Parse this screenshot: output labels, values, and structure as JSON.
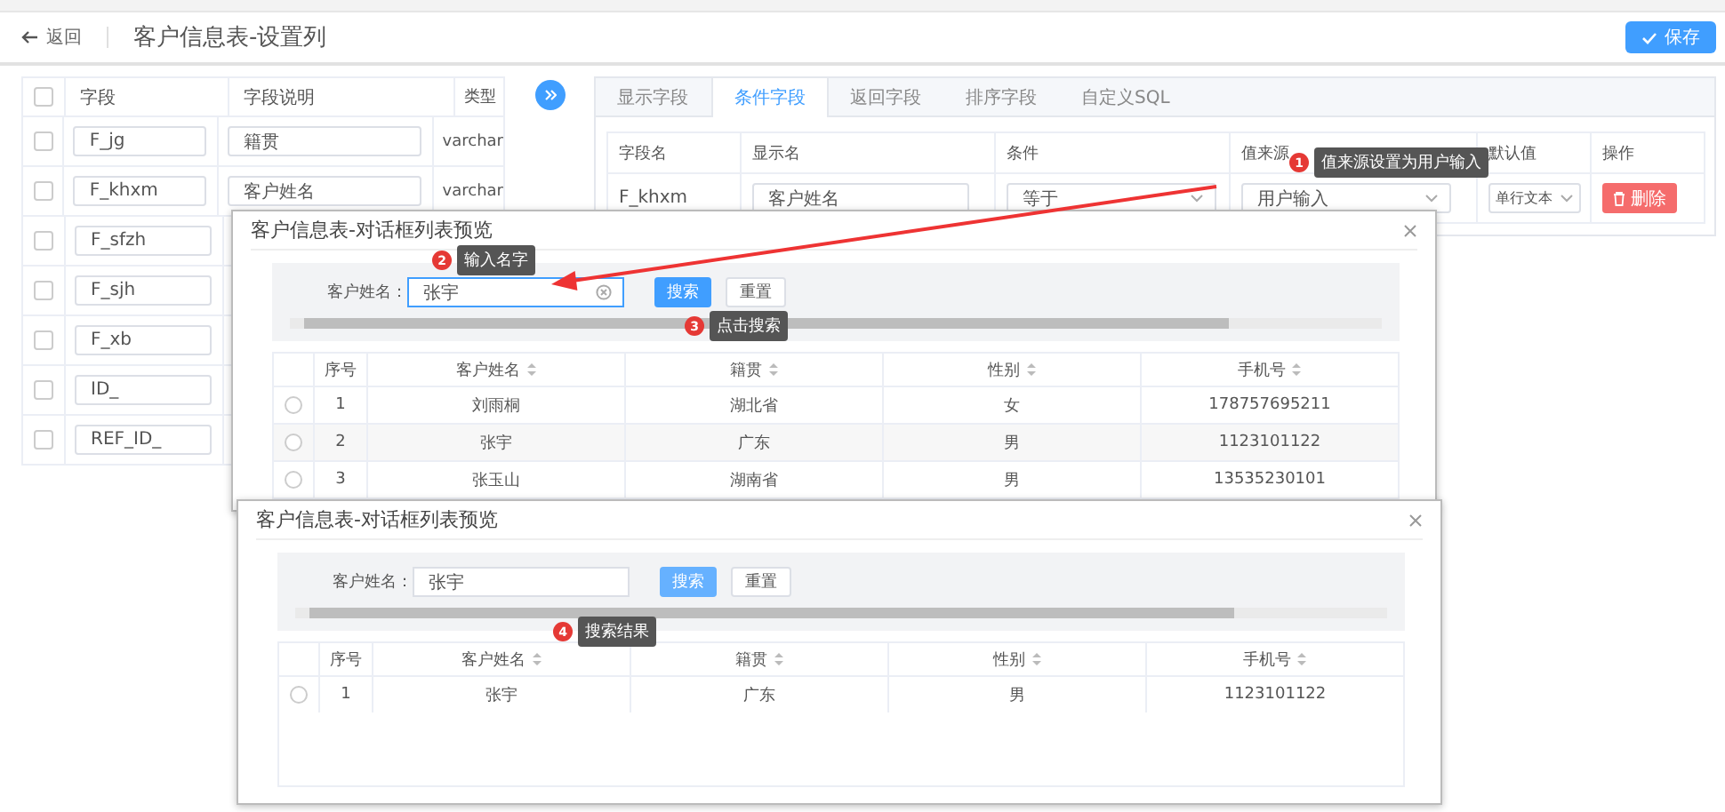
{
  "header": {
    "back": "返回",
    "title": "客户信息表-设置列",
    "save": "保存"
  },
  "field_table": {
    "all_checked": false,
    "columns": [
      "字段",
      "字段说明",
      "类型"
    ],
    "rows": [
      {
        "field": "F_jg",
        "description": "籍贯",
        "type": "varchar",
        "checked": false
      },
      {
        "field": "F_khxm",
        "description": "客户姓名",
        "type": "varchar",
        "checked": false
      },
      {
        "field": "F_sfzh",
        "checked": false
      },
      {
        "field": "F_sjh",
        "checked": false
      },
      {
        "field": "F_xb",
        "checked": false
      },
      {
        "field": "ID_",
        "checked": false
      },
      {
        "field": "REF_ID_",
        "checked": false
      }
    ]
  },
  "config_panel": {
    "tabs": [
      {
        "label": "显示字段",
        "selected": false
      },
      {
        "label": "条件字段",
        "selected": true
      },
      {
        "label": "返回字段",
        "selected": false
      },
      {
        "label": "排序字段",
        "selected": false
      },
      {
        "label": "自定义SQL",
        "selected": false
      }
    ],
    "columns": [
      "字段名",
      "显示名",
      "条件",
      "值来源",
      "默认值",
      "操作"
    ],
    "rows": [
      {
        "field_name": "F_khxm",
        "display_name": "客户姓名",
        "condition": "等于",
        "value_source": "用户输入",
        "default_value": "单行文本",
        "action": "删除"
      }
    ]
  },
  "dialogs": [
    {
      "title": "客户信息表-对话框列表预览",
      "search_label": "客户姓名：",
      "search_value": "张宇",
      "focused": true,
      "search_button": "搜索",
      "reset_button": "重置",
      "columns": [
        "序号",
        "客户姓名",
        "籍贯",
        "性别",
        "手机号"
      ],
      "rows": [
        {
          "index": "1",
          "name": "刘雨桐",
          "origin": "湖北省",
          "gender": "女",
          "phone": "178757695211",
          "selected": false
        },
        {
          "index": "2",
          "name": "张宇",
          "origin": "广东",
          "gender": "男",
          "phone": "1123101122",
          "selected": false
        },
        {
          "index": "3",
          "name": "张玉山",
          "origin": "湖南省",
          "gender": "男",
          "phone": "13535230101",
          "selected": false
        }
      ]
    },
    {
      "title": "客户信息表-对话框列表预览",
      "search_label": "客户姓名：",
      "search_value": "张宇",
      "focused": false,
      "search_button": "搜索",
      "reset_button": "重置",
      "columns": [
        "序号",
        "客户姓名",
        "籍贯",
        "性别",
        "手机号"
      ],
      "rows": [
        {
          "index": "1",
          "name": "张宇",
          "origin": "广东",
          "gender": "男",
          "phone": "1123101122",
          "selected": false
        }
      ]
    }
  ],
  "annotations": [
    {
      "number": "1",
      "text": "值来源设置为用户输入"
    },
    {
      "number": "2",
      "text": "输入名字"
    },
    {
      "number": "3",
      "text": "点击搜索"
    },
    {
      "number": "4",
      "text": "搜索结果"
    }
  ]
}
